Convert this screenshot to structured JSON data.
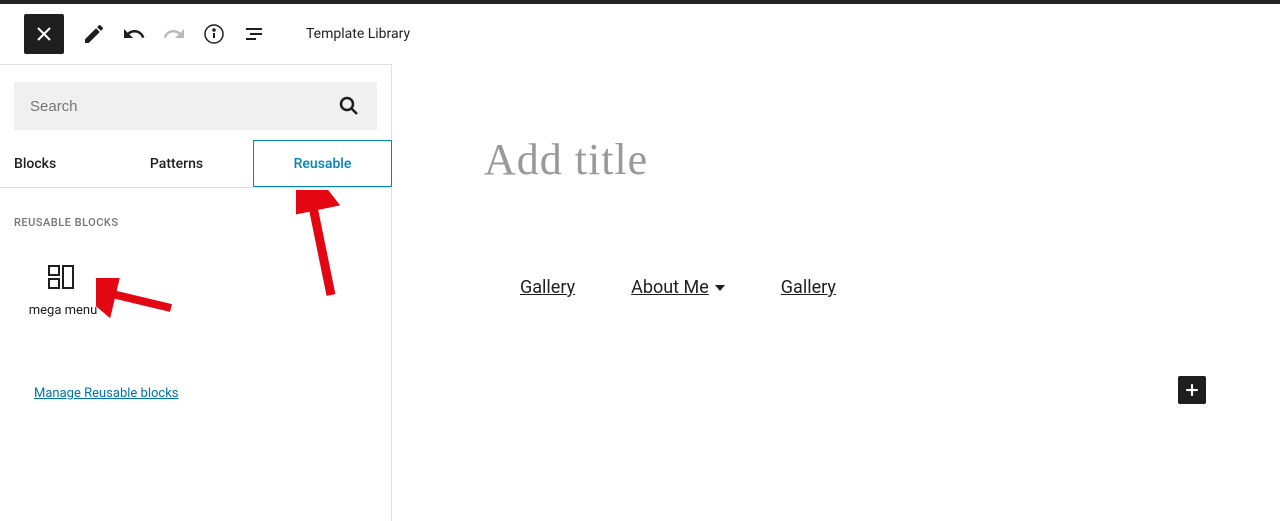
{
  "toolbar": {
    "template_library_label": "Template Library"
  },
  "sidebar": {
    "search_placeholder": "Search",
    "tabs": {
      "blocks": "Blocks",
      "patterns": "Patterns",
      "reusable": "Reusable"
    },
    "section_title": "Reusable Blocks",
    "blocks": [
      {
        "label": "mega menu"
      }
    ],
    "manage_link": "Manage Reusable blocks"
  },
  "editor": {
    "title_placeholder": "Add title",
    "nav_items": [
      {
        "label": "Gallery",
        "has_dropdown": false
      },
      {
        "label": "About Me",
        "has_dropdown": true
      },
      {
        "label": "Gallery",
        "has_dropdown": false
      }
    ]
  }
}
